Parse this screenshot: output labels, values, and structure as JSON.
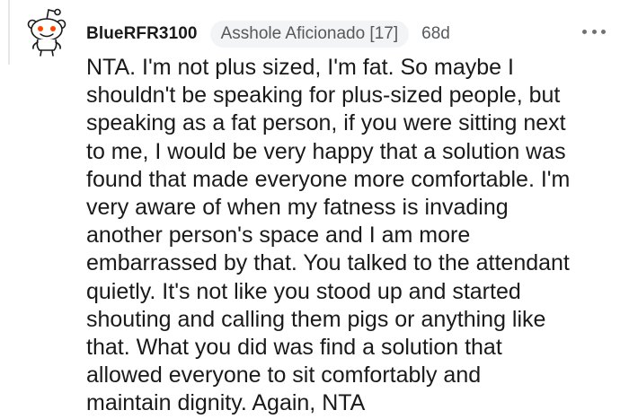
{
  "comment": {
    "username": "BlueRFR3100",
    "flair": "Asshole Aficionado [17]",
    "timestamp": "68d",
    "more_icon": "more-horizontal-icon",
    "avatar_icon": "snoo-avatar-icon",
    "body_lines": [
      "NTA. I'm not plus sized, I'm fat. So maybe I",
      "shouldn't be speaking for plus-sized people, but",
      "speaking as a fat person, if you were sitting next",
      "to me, I would be very happy that a solution was",
      "found that made everyone more comfortable. I'm",
      "very aware of when my fatness is invading",
      "another person's space and I am more",
      "embarrassed by that. You talked to the attendant",
      "quietly. It's not like you stood up and started",
      "shouting and calling them pigs or anything like",
      "that. What you did was find a solution that",
      "allowed everyone to sit comfortably and",
      "maintain dignity. Again, NTA"
    ]
  },
  "colors": {
    "text": "#1a1a1b",
    "meta": "#55595c",
    "flair_bg": "#f3f4f5",
    "avatar_red": "#ff4500"
  }
}
